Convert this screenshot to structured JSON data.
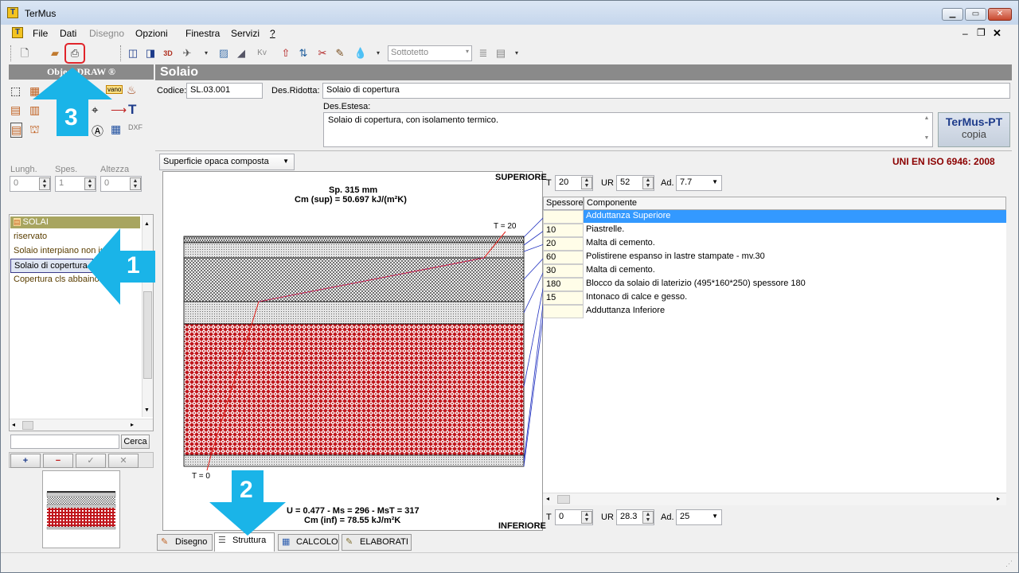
{
  "window": {
    "title": "TerMus"
  },
  "menu": [
    "File",
    "Dati",
    "Disegno",
    "Opzioni",
    "Finestra",
    "Servizi",
    "?"
  ],
  "toolbar": {
    "combo_value": "Sottotetto"
  },
  "left": {
    "header": "Object DRAW ®",
    "dims": {
      "lungh_label": "Lungh.",
      "lungh_value": "0",
      "spes_label": "Spes.",
      "spes_value": "1",
      "altezza_label": "Altezza",
      "altezza_value": "0"
    },
    "list_header": "SOLAI",
    "list_items": [
      "riservato",
      "Solaio interpiano non is",
      "Solaio di copertura",
      "Copertura cls abbaino"
    ],
    "search_button": "Cerca",
    "buttons": [
      "+",
      "−",
      "✓",
      "✕"
    ]
  },
  "main": {
    "title": "Solaio",
    "codice_label": "Codice:",
    "codice": "SL.03.001",
    "desridotta_label": "Des.Ridotta:",
    "desridotta": "Solaio di copertura",
    "desestesa_label": "Des.Estesa:",
    "desestesa": "Solaio di copertura, con isolamento termico.",
    "logo_line1": "TerMus-PT",
    "logo_line2": "copia",
    "type_select": "Superficie opaca composta",
    "norm": "UNI EN ISO 6946: 2008"
  },
  "drawing": {
    "sp": "Sp. 315 mm",
    "cm_sup": "Cm (sup) = 50.697 kJ/(m²K)",
    "superiore": "SUPERIORE",
    "inferiore": "INFERIORE",
    "t_top": "T = 20",
    "t_bot": "T = 0",
    "u_line": "U = 0.477 - Ms = 296 - MsT = 317",
    "cm_inf": "Cm (inf) = 78.55 kJ/m²K"
  },
  "conditions": {
    "top": {
      "t_label": "T",
      "t": "20",
      "ur_label": "UR",
      "ur": "52",
      "ad_label": "Ad.",
      "ad": "7.7"
    },
    "bottom": {
      "t_label": "T",
      "t": "0",
      "ur_label": "UR",
      "ur": "28.3",
      "ad_label": "Ad.",
      "ad": "25"
    }
  },
  "layers": {
    "headers": [
      "Spessore",
      "Componente"
    ],
    "rows": [
      {
        "s": "",
        "c": "Adduttanza Superiore"
      },
      {
        "s": "10",
        "c": "Piastrelle."
      },
      {
        "s": "20",
        "c": "Malta di cemento."
      },
      {
        "s": "60",
        "c": "Polistirene espanso in lastre stampate - mv.30"
      },
      {
        "s": "30",
        "c": "Malta di cemento."
      },
      {
        "s": "180",
        "c": "Blocco da solaio di laterizio (495*160*250) spessore 180"
      },
      {
        "s": "15",
        "c": "Intonaco di calce e gesso."
      },
      {
        "s": "",
        "c": "Adduttanza Inferiore"
      }
    ]
  },
  "tabs": [
    "Disegno",
    "Struttura",
    "CALCOLO",
    "ELABORATI"
  ],
  "callouts": [
    "1",
    "2",
    "3"
  ],
  "colors": {
    "header_gray": "#8a8a8a",
    "selection": "#3399ff",
    "callout": "#1ab4e8",
    "brick": "#c0161c",
    "norm": "#8b0000"
  }
}
